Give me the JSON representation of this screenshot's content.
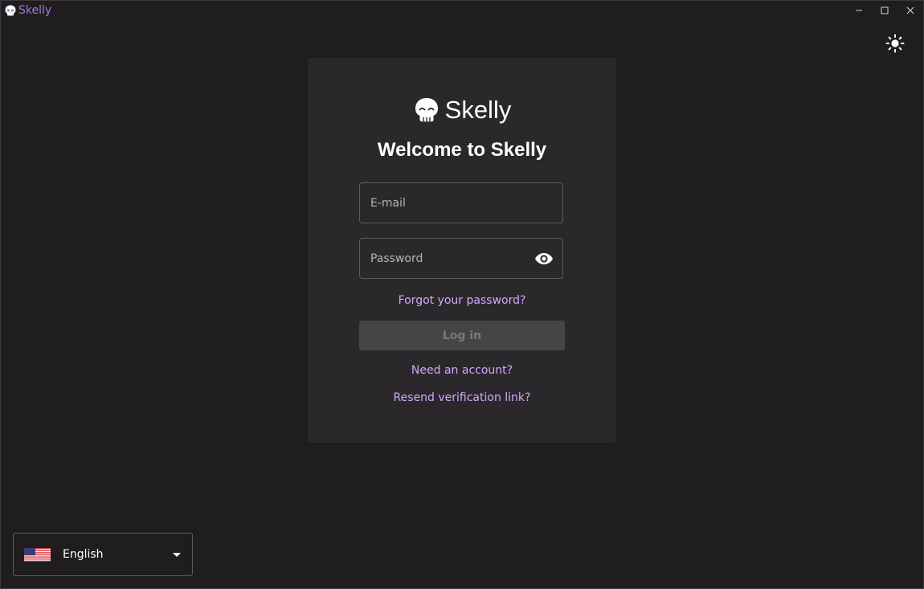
{
  "app": {
    "title": "Skelly",
    "accent_color": "#a777d6",
    "logo_icon": "skull-icon"
  },
  "window_controls": {
    "minimize_icon": "minimize-icon",
    "maximize_icon": "maximize-icon",
    "close_icon": "close-icon"
  },
  "theme_toggle": {
    "icon": "sun-icon"
  },
  "login": {
    "brand_name": "Skelly",
    "heading": "Welcome to Skelly",
    "email_placeholder": "E-mail",
    "email_value": "",
    "password_placeholder": "Password",
    "password_value": "",
    "password_visibility_icon": "eye-icon",
    "forgot_password": "Forgot your password?",
    "login_button": "Log in",
    "login_enabled": false,
    "need_account": "Need an account?",
    "resend_verification": "Resend verification link?",
    "link_color": "#d3a8ff"
  },
  "language_selector": {
    "selected": "English",
    "flag_icon": "us-flag-icon",
    "dropdown_icon": "caret-down-icon"
  }
}
